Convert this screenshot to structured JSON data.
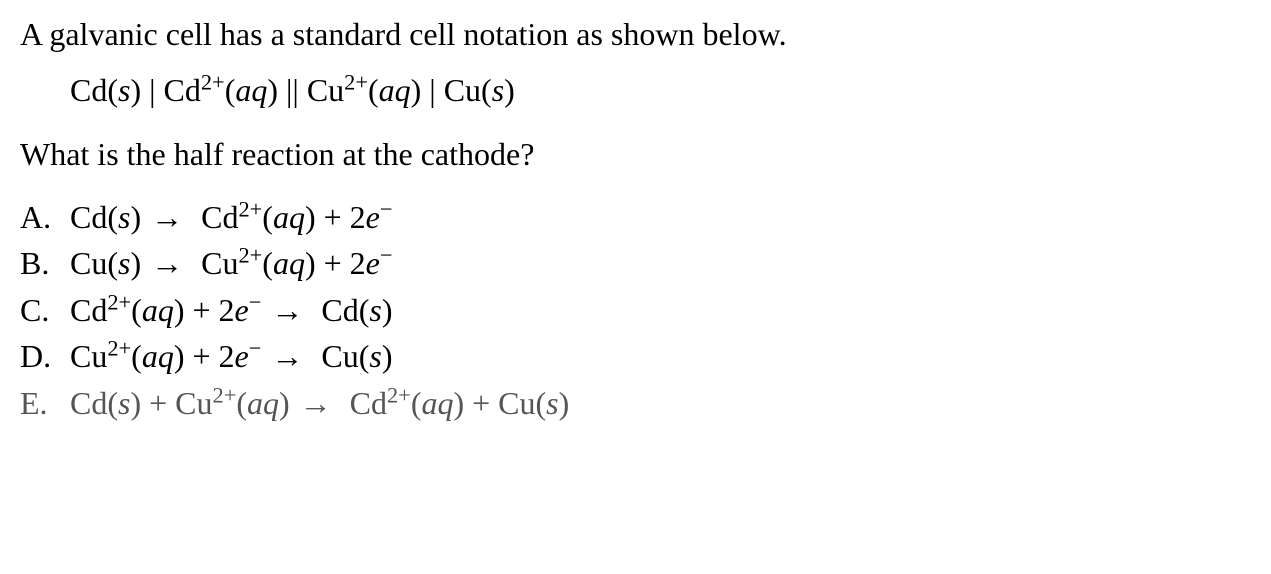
{
  "intro": "A galvanic cell has a standard cell notation as shown below.",
  "notation": {
    "p1": "Cd(",
    "s1": "s",
    "p2": ") | Cd",
    "sup1": "2+",
    "p3": "(",
    "aq1": "aq",
    "p4": ") || Cu",
    "sup2": "2+",
    "p5": "(",
    "aq2": "aq",
    "p6": ") | Cu(",
    "s2": "s",
    "p7": ")"
  },
  "question": "What is the half reaction at the cathode?",
  "labels": {
    "A": "A.",
    "B": "B.",
    "C": "C.",
    "D": "D.",
    "E": "E."
  },
  "optA": {
    "l1": "Cd(",
    "s1": "s",
    "l2": ")",
    "arrow": "→",
    "r1": " Cd",
    "sup": "2+",
    "r2": "(",
    "aq": "aq",
    "r3": ") + 2",
    "e": "e",
    "esup": "−"
  },
  "optB": {
    "l1": "Cu(",
    "s1": "s",
    "l2": ")",
    "arrow": "→",
    "r1": " Cu",
    "sup": "2+",
    "r2": "(",
    "aq": "aq",
    "r3": ") + 2",
    "e": "e",
    "esup": "−"
  },
  "optC": {
    "l1": "Cd",
    "sup": "2+",
    "l2": "(",
    "aq": "aq",
    "l3": ") + 2",
    "e": "e",
    "esup": "−",
    "arrow": "→",
    "r1": " Cd(",
    "s1": "s",
    "r2": ")"
  },
  "optD": {
    "l1": "Cu",
    "sup": "2+",
    "l2": "(",
    "aq": "aq",
    "l3": ") + 2",
    "e": "e",
    "esup": "−",
    "arrow": "→",
    "r1": " Cu(",
    "s1": "s",
    "r2": ")"
  },
  "optE": {
    "l1": "Cd(",
    "s1": "s",
    "l2": ") + Cu",
    "sup1": "2+",
    "l3": "(",
    "aq1": "aq",
    "l4": ")",
    "arrow": "→",
    "r1": " Cd",
    "sup2": "2+",
    "r2": "(",
    "aq2": "aq",
    "r3": ") + Cu(",
    "s2": "s",
    "r4": ")"
  }
}
